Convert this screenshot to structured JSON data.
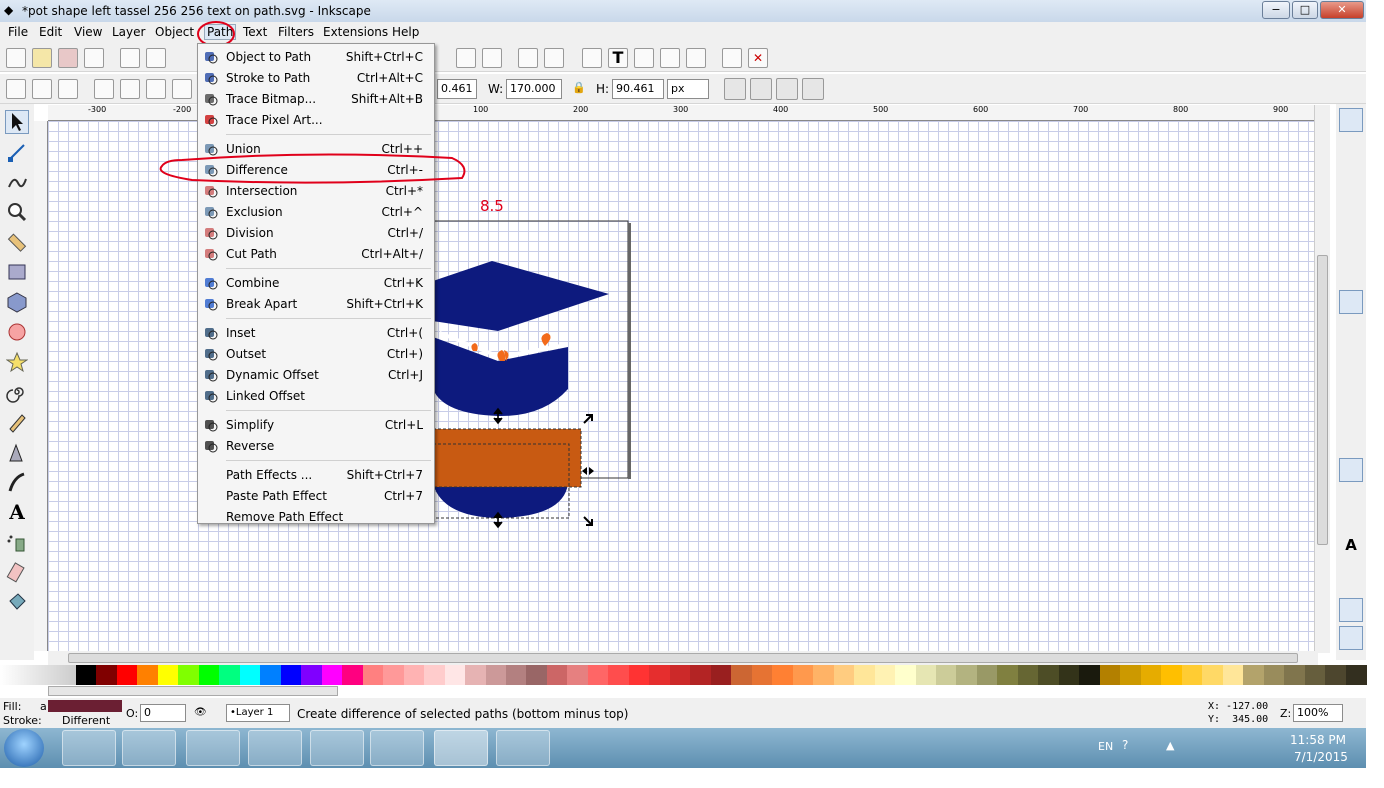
{
  "window": {
    "title": "*pot shape left tassel 256 256 text on path.svg - Inkscape",
    "controls": {
      "minimize": "−",
      "maximize": "□",
      "close": "✕"
    }
  },
  "menubar": [
    {
      "label": "File"
    },
    {
      "label": "Edit"
    },
    {
      "label": "View"
    },
    {
      "label": "Layer"
    },
    {
      "label": "Object"
    },
    {
      "label": "Path"
    },
    {
      "label": "Text"
    },
    {
      "label": "Filters"
    },
    {
      "label": "Extensions"
    },
    {
      "label": "Help"
    }
  ],
  "select_toolbar": {
    "x_value": "0.461",
    "w_label": "W:",
    "w_value": "170.000",
    "h_label": "H:",
    "h_value": "90.461",
    "unit": "px"
  },
  "ruler_top_labels": [
    "-300",
    "-200",
    "100",
    "200",
    "300",
    "400",
    "500",
    "600",
    "700",
    "800",
    "900"
  ],
  "path_menu": {
    "groups": [
      [
        {
          "label": "Object to Path",
          "shortcut": "Shift+Ctrl+C",
          "icon": "object-to-path-icon",
          "color": "#3355aa"
        },
        {
          "label": "Stroke to Path",
          "shortcut": "Ctrl+Alt+C",
          "icon": "stroke-to-path-icon",
          "color": "#3355aa"
        },
        {
          "label": "Trace Bitmap...",
          "shortcut": "Shift+Alt+B",
          "icon": "trace-bitmap-icon",
          "color": "#555555"
        },
        {
          "label": "Trace Pixel Art...",
          "shortcut": "",
          "icon": "trace-pixel-art-icon",
          "color": "#cc2222"
        }
      ],
      [
        {
          "label": "Union",
          "shortcut": "Ctrl++",
          "icon": "union-icon",
          "color": "#6688aa"
        },
        {
          "label": "Difference",
          "shortcut": "Ctrl+-",
          "icon": "difference-icon",
          "color": "#6688aa"
        },
        {
          "label": "Intersection",
          "shortcut": "Ctrl+*",
          "icon": "intersection-icon",
          "color": "#cc6666"
        },
        {
          "label": "Exclusion",
          "shortcut": "Ctrl+^",
          "icon": "exclusion-icon",
          "color": "#6688aa"
        },
        {
          "label": "Division",
          "shortcut": "Ctrl+/",
          "icon": "division-icon",
          "color": "#cc6666"
        },
        {
          "label": "Cut Path",
          "shortcut": "Ctrl+Alt+/",
          "icon": "cut-path-icon",
          "color": "#cc6666"
        }
      ],
      [
        {
          "label": "Combine",
          "shortcut": "Ctrl+K",
          "icon": "combine-icon",
          "color": "#3366cc"
        },
        {
          "label": "Break Apart",
          "shortcut": "Shift+Ctrl+K",
          "icon": "break-apart-icon",
          "color": "#3366cc"
        }
      ],
      [
        {
          "label": "Inset",
          "shortcut": "Ctrl+(",
          "icon": "inset-icon",
          "color": "#335577"
        },
        {
          "label": "Outset",
          "shortcut": "Ctrl+)",
          "icon": "outset-icon",
          "color": "#335577"
        },
        {
          "label": "Dynamic Offset",
          "shortcut": "Ctrl+J",
          "icon": "dynamic-offset-icon",
          "color": "#335577"
        },
        {
          "label": "Linked Offset",
          "shortcut": "",
          "icon": "linked-offset-icon",
          "color": "#335577"
        }
      ],
      [
        {
          "label": "Simplify",
          "shortcut": "Ctrl+L",
          "icon": "simplify-icon",
          "color": "#333333"
        },
        {
          "label": "Reverse",
          "shortcut": "",
          "icon": "reverse-icon",
          "color": "#333333"
        }
      ],
      [
        {
          "label": "Path Effects ...",
          "shortcut": "Shift+Ctrl+7",
          "icon": "",
          "color": ""
        },
        {
          "label": "Paste Path Effect",
          "shortcut": "Ctrl+7",
          "icon": "",
          "color": ""
        },
        {
          "label": "Remove Path Effect",
          "shortcut": "",
          "icon": "",
          "color": ""
        }
      ]
    ]
  },
  "canvas": {
    "page_label": "8.5",
    "colors": {
      "cap": "#0d1a7e",
      "tassel": "#f26a1b",
      "pot": "#c85a12",
      "annotation": "#e0001a"
    }
  },
  "statusbar": {
    "fill_label": "Fill:",
    "fill_value": "a",
    "stroke_label": "Stroke:",
    "stroke_value": "Different",
    "fill_color": "#6b1f33",
    "opacity_label": "O:",
    "opacity_value": "0",
    "layer": "•Layer 1",
    "message": "Create difference of selected paths (bottom minus top)",
    "x_coord": "X: -127.00",
    "y_coord": "Y:  345.00",
    "zoom_label": "Z:",
    "zoom_value": "100%"
  },
  "taskbar": {
    "language": "EN",
    "time": "11:58 PM",
    "date": "7/1/2015"
  },
  "palette_colors": [
    "#000000",
    "#800000",
    "#ff0000",
    "#ff8000",
    "#ffff00",
    "#80ff00",
    "#00ff00",
    "#00ff80",
    "#00ffff",
    "#0080ff",
    "#0000ff",
    "#8000ff",
    "#ff00ff",
    "#ff0080",
    "#ff8080",
    "#ff9999",
    "#ffb3b3",
    "#ffcccc",
    "#ffe6e6",
    "#e6b3b3",
    "#cc9999",
    "#b38080",
    "#996666",
    "#cc6666",
    "#e68080",
    "#ff6666",
    "#ff4d4d",
    "#ff3333",
    "#e62e2e",
    "#cc2929",
    "#b32424",
    "#991f1f",
    "#cc6633",
    "#e67333",
    "#ff8033",
    "#ff994d",
    "#ffb366",
    "#ffcc80",
    "#ffe699",
    "#fff2b3",
    "#ffffcc",
    "#e6e6b3",
    "#cccc99",
    "#b3b380",
    "#999966",
    "#808040",
    "#666633",
    "#4d4d26",
    "#333319",
    "#1a1a0d",
    "#b38000",
    "#cc9900",
    "#e6ac00",
    "#ffbf00",
    "#ffcc33",
    "#ffd966",
    "#ffe699",
    "#b3a36b",
    "#998c5c",
    "#80754d",
    "#665e3d",
    "#4d462e",
    "#332f1f"
  ]
}
